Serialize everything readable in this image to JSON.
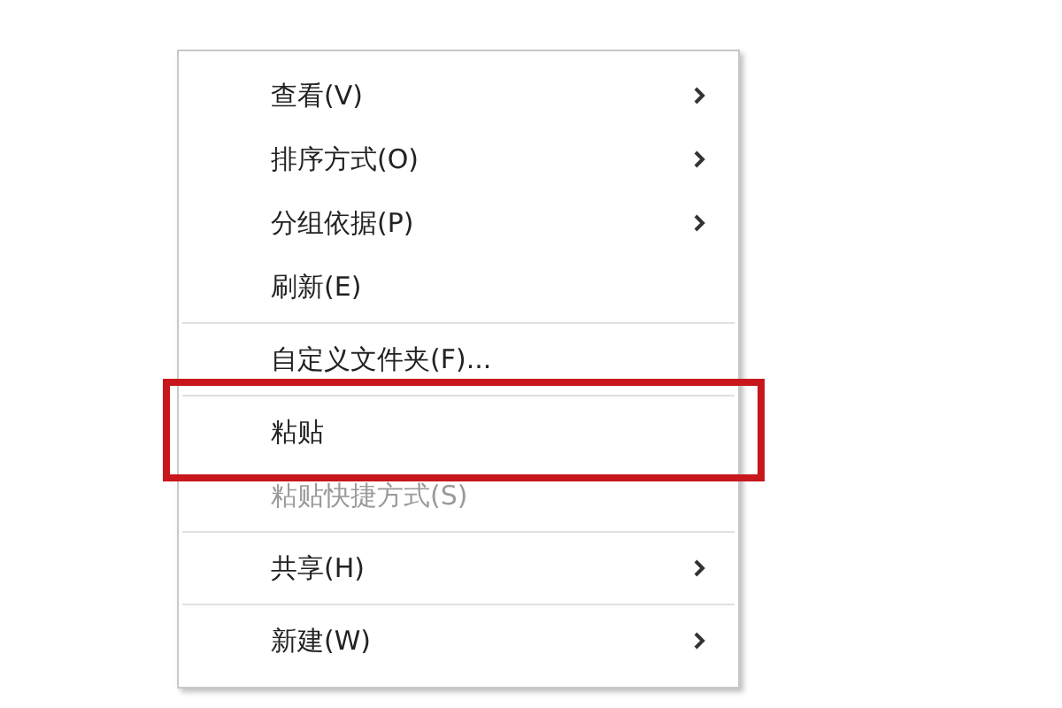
{
  "context_menu": {
    "items": [
      {
        "kind": "item",
        "label": "查看(V)",
        "submenu": true,
        "disabled": false,
        "highlighted": false
      },
      {
        "kind": "item",
        "label": "排序方式(O)",
        "submenu": true,
        "disabled": false,
        "highlighted": false
      },
      {
        "kind": "item",
        "label": "分组依据(P)",
        "submenu": true,
        "disabled": false,
        "highlighted": false
      },
      {
        "kind": "item",
        "label": "刷新(E)",
        "submenu": false,
        "disabled": false,
        "highlighted": false
      },
      {
        "kind": "separator"
      },
      {
        "kind": "item",
        "label": "自定义文件夹(F)...",
        "submenu": false,
        "disabled": false,
        "highlighted": false
      },
      {
        "kind": "separator"
      },
      {
        "kind": "item",
        "label": "粘贴",
        "submenu": false,
        "disabled": false,
        "highlighted": true
      },
      {
        "kind": "item",
        "label": "粘贴快捷方式(S)",
        "submenu": false,
        "disabled": true,
        "highlighted": false
      },
      {
        "kind": "separator"
      },
      {
        "kind": "item",
        "label": "共享(H)",
        "submenu": true,
        "disabled": false,
        "highlighted": false
      },
      {
        "kind": "separator"
      },
      {
        "kind": "item",
        "label": "新建(W)",
        "submenu": true,
        "disabled": false,
        "highlighted": false
      }
    ]
  }
}
